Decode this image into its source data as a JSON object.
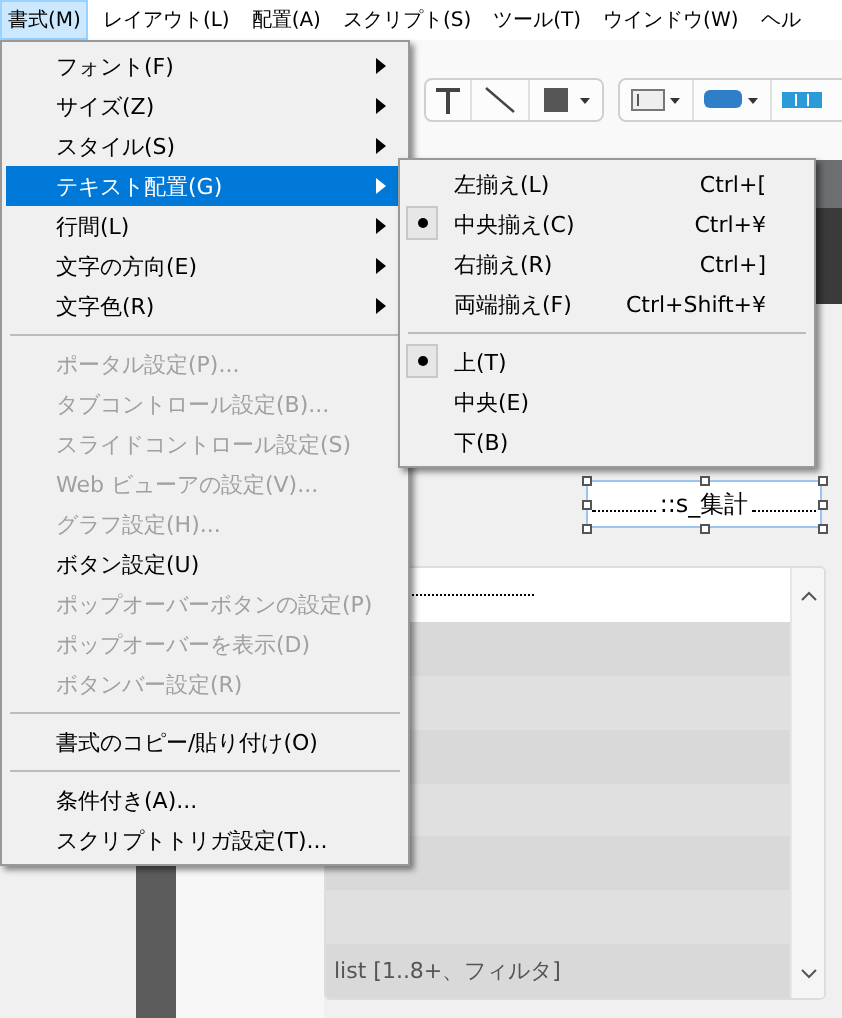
{
  "menubar": [
    {
      "label": "書式(M)",
      "selected": true
    },
    {
      "label": "レイアウト(L)",
      "selected": false
    },
    {
      "label": "配置(A)",
      "selected": false
    },
    {
      "label": "スクリプト(S)",
      "selected": false
    },
    {
      "label": "ツール(T)",
      "selected": false
    },
    {
      "label": "ウインドウ(W)",
      "selected": false
    },
    {
      "label": "ヘル",
      "selected": false
    }
  ],
  "menu": {
    "items": [
      {
        "kind": "item",
        "label": "フォント(F)",
        "submenu": true,
        "disabled": false,
        "selected": false
      },
      {
        "kind": "item",
        "label": "サイズ(Z)",
        "submenu": true,
        "disabled": false,
        "selected": false
      },
      {
        "kind": "item",
        "label": "スタイル(S)",
        "submenu": true,
        "disabled": false,
        "selected": false
      },
      {
        "kind": "item",
        "label": "テキスト配置(G)",
        "submenu": true,
        "disabled": false,
        "selected": true
      },
      {
        "kind": "item",
        "label": "行間(L)",
        "submenu": true,
        "disabled": false,
        "selected": false
      },
      {
        "kind": "item",
        "label": "文字の方向(E)",
        "submenu": true,
        "disabled": false,
        "selected": false
      },
      {
        "kind": "item",
        "label": "文字色(R)",
        "submenu": true,
        "disabled": false,
        "selected": false
      },
      {
        "kind": "separator"
      },
      {
        "kind": "item",
        "label": "ポータル設定(P)...",
        "submenu": false,
        "disabled": true,
        "selected": false
      },
      {
        "kind": "item",
        "label": "タブコントロール設定(B)...",
        "submenu": false,
        "disabled": true,
        "selected": false
      },
      {
        "kind": "item",
        "label": "スライドコントロール設定(S)",
        "submenu": false,
        "disabled": true,
        "selected": false
      },
      {
        "kind": "item",
        "label": "Web ビューアの設定(V)...",
        "submenu": false,
        "disabled": true,
        "selected": false
      },
      {
        "kind": "item",
        "label": "グラフ設定(H)...",
        "submenu": false,
        "disabled": true,
        "selected": false
      },
      {
        "kind": "item",
        "label": "ボタン設定(U)",
        "submenu": false,
        "disabled": false,
        "selected": false
      },
      {
        "kind": "item",
        "label": "ポップオーバーボタンの設定(P)",
        "submenu": false,
        "disabled": true,
        "selected": false
      },
      {
        "kind": "item",
        "label": "ポップオーバーを表示(D)",
        "submenu": false,
        "disabled": true,
        "selected": false
      },
      {
        "kind": "item",
        "label": "ボタンバー設定(R)",
        "submenu": false,
        "disabled": true,
        "selected": false
      },
      {
        "kind": "separator"
      },
      {
        "kind": "item",
        "label": "書式のコピー/貼り付け(O)",
        "submenu": false,
        "disabled": false,
        "selected": false
      },
      {
        "kind": "separator"
      },
      {
        "kind": "item",
        "label": "条件付き(A)...",
        "submenu": false,
        "disabled": false,
        "selected": false
      },
      {
        "kind": "item",
        "label": "スクリプトトリガ設定(T)...",
        "submenu": false,
        "disabled": false,
        "selected": false
      }
    ]
  },
  "submenu": {
    "items": [
      {
        "kind": "item",
        "label": "左揃え(L)",
        "shortcut": "Ctrl+[",
        "checked": false
      },
      {
        "kind": "item",
        "label": "中央揃え(C)",
        "shortcut": "Ctrl+¥",
        "checked": true
      },
      {
        "kind": "item",
        "label": "右揃え(R)",
        "shortcut": "Ctrl+]",
        "checked": false
      },
      {
        "kind": "item",
        "label": "両端揃え(F)",
        "shortcut": "Ctrl+Shift+¥",
        "checked": false
      },
      {
        "kind": "separator"
      },
      {
        "kind": "item",
        "label": "上(T)",
        "checked": true
      },
      {
        "kind": "item",
        "label": "中央(E)",
        "checked": false
      },
      {
        "kind": "item",
        "label": "下(B)",
        "checked": false
      }
    ]
  },
  "layout": {
    "field": {
      "text": "::s_集計",
      "selected": true
    },
    "portal": {
      "label": "list [1..8+、フィルタ]"
    }
  }
}
